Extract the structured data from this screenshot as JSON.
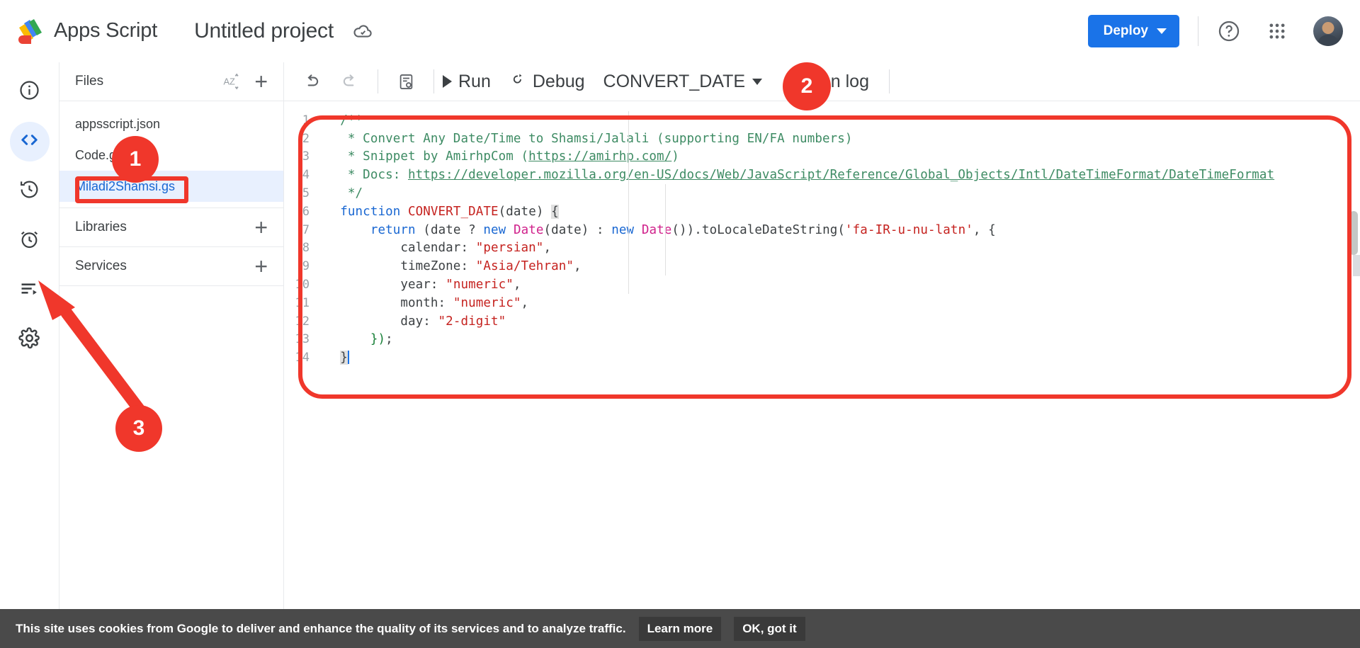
{
  "header": {
    "logo_icon": "apps-script-logo",
    "brand": "Apps Script",
    "project_title": "Untitled project",
    "cloud_icon": "cloud-saved-icon",
    "deploy_label": "Deploy",
    "help_icon": "help-question-icon",
    "apps_icon": "google-apps-grid-icon",
    "avatar_label": "account-avatar"
  },
  "rail": {
    "items": [
      {
        "name": "overview",
        "icon": "info-circle-icon",
        "active": false
      },
      {
        "name": "editor",
        "icon": "code-brackets-icon",
        "active": true
      },
      {
        "name": "project-history",
        "icon": "history-clock-icon",
        "active": false
      },
      {
        "name": "triggers",
        "icon": "alarm-clock-icon",
        "active": false
      },
      {
        "name": "executions",
        "icon": "executions-list-icon",
        "active": false
      },
      {
        "name": "project-settings",
        "icon": "gear-icon",
        "active": false
      }
    ]
  },
  "files_panel": {
    "files_label": "Files",
    "sort_icon": "sort-az-icon",
    "add_file_icon": "plus-icon",
    "files": [
      {
        "name": "appsscript.json",
        "selected": false
      },
      {
        "name": "Code.gs",
        "selected": false
      },
      {
        "name": "Miladi2Shamsi.gs",
        "selected": true
      }
    ],
    "libraries_label": "Libraries",
    "libraries_add_icon": "plus-icon",
    "services_label": "Services",
    "services_add_icon": "plus-icon"
  },
  "editor_toolbar": {
    "undo_icon": "undo-arrow-icon",
    "redo_icon": "redo-arrow-icon",
    "format_icon": "format-document-icon",
    "run_label": "Run",
    "run_icon": "play-triangle-icon",
    "debug_label": "Debug",
    "debug_icon": "debug-bug-icon",
    "function_selected": "CONVERT_DATE",
    "function_caret_icon": "chevron-down-icon",
    "execution_log_label": "ecution log",
    "execution_log_full": "Execution log"
  },
  "code": {
    "language": "javascript",
    "cursor_line": 14,
    "lines": [
      {
        "n": 1,
        "text": "/**"
      },
      {
        "n": 2,
        "text": " * Convert Any Date/Time to Shamsi/Jalali (supporting EN/FA numbers)"
      },
      {
        "n": 3,
        "text": " * Snippet by AmirhpCom (https://amirhp.com/)"
      },
      {
        "n": 4,
        "text": " * Docs: https://developer.mozilla.org/en-US/docs/Web/JavaScript/Reference/Global_Objects/Intl/DateTimeFormat/DateTimeFormat"
      },
      {
        "n": 5,
        "text": " */"
      },
      {
        "n": 6,
        "text": "function CONVERT_DATE(date) {"
      },
      {
        "n": 7,
        "text": "   return (date ? new Date(date) : new Date()).toLocaleDateString('fa-IR-u-nu-latn', {"
      },
      {
        "n": 8,
        "text": "      calendar: \"persian\","
      },
      {
        "n": 9,
        "text": "      timeZone: \"Asia/Tehran\","
      },
      {
        "n": 10,
        "text": "      year: \"numeric\","
      },
      {
        "n": 11,
        "text": "      month: \"numeric\","
      },
      {
        "n": 12,
        "text": "      day: \"2-digit\""
      },
      {
        "n": 13,
        "text": "   });"
      },
      {
        "n": 14,
        "text": "}"
      }
    ]
  },
  "cookie_banner": {
    "message": "This site uses cookies from Google to deliver and enhance the quality of its services and to analyze traffic.",
    "learn_more_label": "Learn more",
    "ok_label": "OK, got it"
  },
  "annotations": {
    "badges": [
      {
        "id": "1",
        "label": "1",
        "target": "file-miladi2shamsi"
      },
      {
        "id": "2",
        "label": "2",
        "target": "function-selector"
      },
      {
        "id": "3",
        "label": "3",
        "target": "project-settings-gear"
      }
    ],
    "accent_color": "#f0372b"
  }
}
